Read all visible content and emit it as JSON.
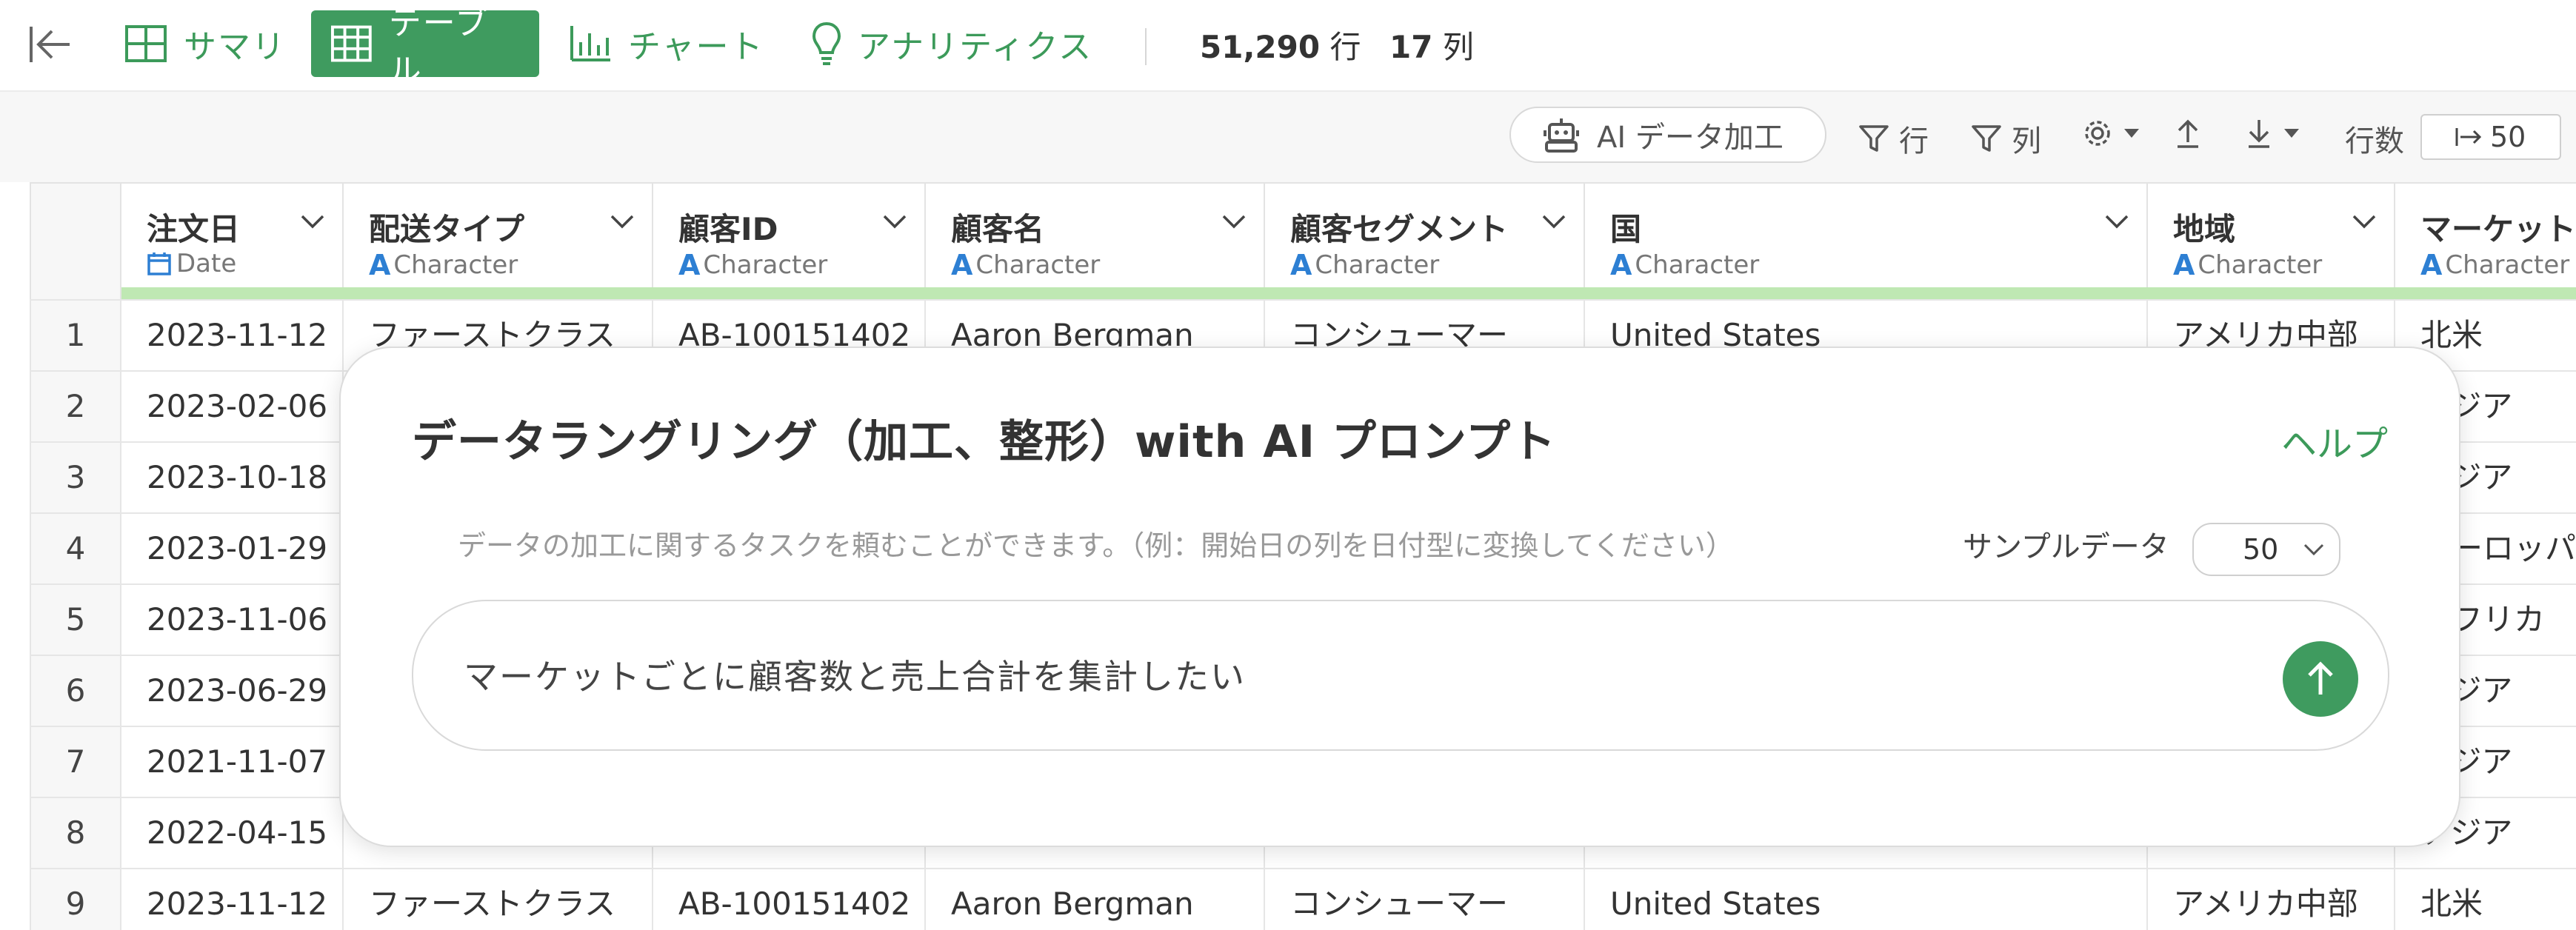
{
  "nav": {
    "tabs": [
      {
        "label": "サマリ",
        "icon": "grid-icon"
      },
      {
        "label": "テーブル",
        "icon": "table-icon",
        "active": true
      },
      {
        "label": "チャート",
        "icon": "bar-chart-icon"
      },
      {
        "label": "アナリティクス",
        "icon": "lightbulb-icon"
      }
    ],
    "row_count": "51,290",
    "row_unit": "行",
    "col_count": "17",
    "col_unit": "列"
  },
  "toolbar": {
    "ai_button": "AI データ加工",
    "filter_rows": "行",
    "filter_cols": "列",
    "rows_label": "行数",
    "rows_value": "50"
  },
  "table": {
    "columns": [
      {
        "name": "注文日",
        "type": "Date"
      },
      {
        "name": "配送タイプ",
        "type": "Character"
      },
      {
        "name": "顧客ID",
        "type": "Character"
      },
      {
        "name": "顧客名",
        "type": "Character"
      },
      {
        "name": "顧客セグメント",
        "type": "Character"
      },
      {
        "name": "国",
        "type": "Character"
      },
      {
        "name": "地域",
        "type": "Character"
      },
      {
        "name": "マーケット",
        "type": "Character"
      }
    ],
    "rows": [
      {
        "index": "1",
        "cells": [
          "2023-11-12",
          "ファーストクラス",
          "AB-100151402",
          "Aaron Bergman",
          "コンシューマー",
          "United States",
          "アメリカ中部",
          "北米"
        ]
      },
      {
        "index": "2",
        "cells": [
          "2023-02-06",
          "",
          "",
          "",
          "",
          "",
          "",
          "アジア"
        ]
      },
      {
        "index": "3",
        "cells": [
          "2023-10-18",
          "",
          "",
          "",
          "",
          "",
          "",
          "アジア"
        ]
      },
      {
        "index": "4",
        "cells": [
          "2023-01-29",
          "",
          "",
          "",
          "",
          "",
          "",
          "ヨーロッパ"
        ]
      },
      {
        "index": "5",
        "cells": [
          "2023-11-06",
          "",
          "",
          "",
          "",
          "",
          "",
          "アフリカ"
        ]
      },
      {
        "index": "6",
        "cells": [
          "2023-06-29",
          "",
          "",
          "",
          "",
          "",
          "",
          "アジア"
        ]
      },
      {
        "index": "7",
        "cells": [
          "2021-11-07",
          "",
          "",
          "",
          "",
          "",
          "",
          "アジア"
        ]
      },
      {
        "index": "8",
        "cells": [
          "2022-04-15",
          "",
          "",
          "",
          "",
          "",
          "",
          "アジア"
        ]
      },
      {
        "index": "9",
        "cells": [
          "2023-11-12",
          "ファーストクラス",
          "AB-100151402",
          "Aaron Bergman",
          "コンシューマー",
          "United States",
          "アメリカ中部",
          "北米"
        ]
      }
    ]
  },
  "modal": {
    "title": "データラングリング（加工、整形）with AI プロンプト",
    "help": "ヘルプ",
    "description": "データの加工に関するタスクを頼むことができます。（例：開始日の列を日付型に変換してください）",
    "sample_label": "サンプルデータ",
    "sample_value": "50",
    "prompt": "マーケットごとに顧客数と売上合計を集計したい"
  },
  "colors": {
    "accent": "#3f9b5f",
    "header_bar": "#bfe8b3",
    "type_icon": "#2d7fd3"
  }
}
